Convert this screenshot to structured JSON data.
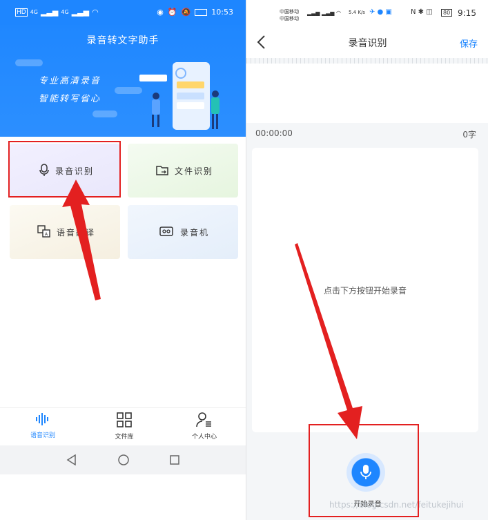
{
  "left": {
    "status": {
      "left_badges": [
        "HD",
        "4G",
        "4G"
      ],
      "time": "10:53"
    },
    "app_title": "录音转文字助手",
    "banner": {
      "line1": "专业高清录音",
      "line2": "智能转写省心"
    },
    "cards": [
      {
        "label": "录音识别",
        "icon": "mic-icon",
        "highlighted": true
      },
      {
        "label": "文件识别",
        "icon": "folder-icon",
        "highlighted": false
      },
      {
        "label": "语音翻译",
        "icon": "translate-icon",
        "highlighted": false
      },
      {
        "label": "录音机",
        "icon": "recorder-icon",
        "highlighted": false
      }
    ],
    "tabs": [
      {
        "label": "语音识别",
        "icon": "waveform-icon",
        "active": true
      },
      {
        "label": "文件库",
        "icon": "grid-icon",
        "active": false
      },
      {
        "label": "个人中心",
        "icon": "profile-icon",
        "active": false
      }
    ]
  },
  "right": {
    "status": {
      "carrier1": "中国移动",
      "carrier2": "中国移动",
      "speed": "5.4 K/s",
      "battery": "80",
      "time": "9:15"
    },
    "nav": {
      "title": "录音识别",
      "save": "保存"
    },
    "elapsed": "00:00:00",
    "char_count": "0字",
    "hint": "点击下方按钮开始录音",
    "record_button_label": "开始录音",
    "watermark": "https://blog.csdn.net/feitukejihui"
  },
  "colors": {
    "accent": "#1e86ff",
    "highlight": "#e32020"
  }
}
